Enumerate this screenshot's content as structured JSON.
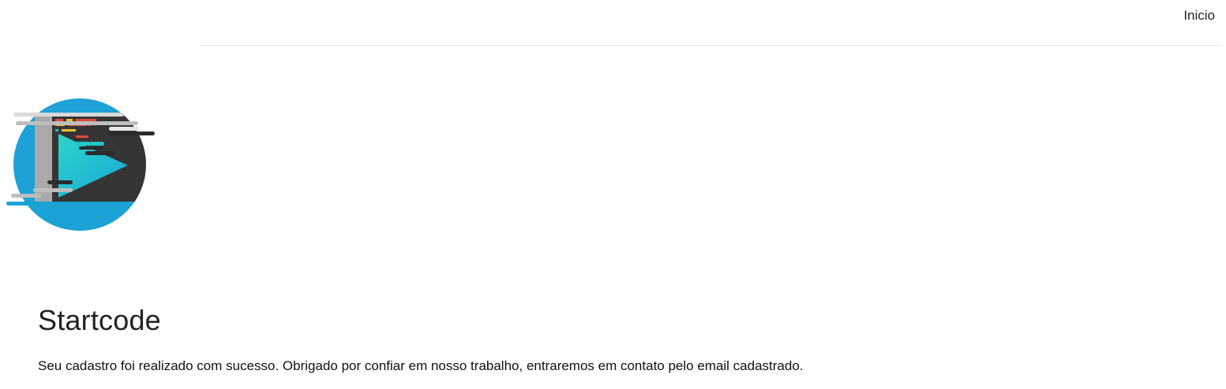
{
  "nav": {
    "home_label": "Inicio"
  },
  "logo": {
    "icon": "startcode-logo-icon",
    "colors": {
      "circle": "#1da1d6",
      "screen": "#353535",
      "play": "#1fc5c9",
      "bars_light": "#d9d9d9",
      "bars_dark": "#2b2b2b"
    }
  },
  "main": {
    "title": "Startcode",
    "message": "Seu cadastro foi realizado com sucesso. Obrigado por confiar em nosso trabalho, entraremos em contato pelo email cadastrado."
  }
}
